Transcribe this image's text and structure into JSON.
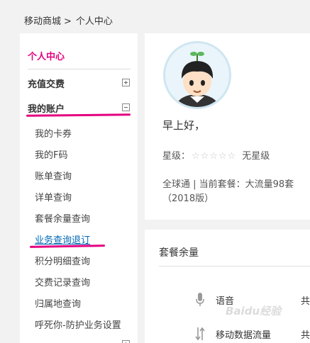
{
  "breadcrumb": {
    "home": "移动商城",
    "separator": ">",
    "current": "个人中心"
  },
  "sidebar": {
    "title": "个人中心",
    "sections": [
      {
        "label": "充值交费",
        "toggle": "plus"
      },
      {
        "label": "我的账户",
        "toggle": "minus"
      }
    ],
    "items": [
      {
        "label": "我的卡券"
      },
      {
        "label": "我的F码"
      },
      {
        "label": "账单查询"
      },
      {
        "label": "详单查询"
      },
      {
        "label": "套餐余量查询"
      },
      {
        "label": "业务查询退订"
      },
      {
        "label": "积分明细查询"
      },
      {
        "label": "交费记录查询"
      },
      {
        "label": "归属地查询"
      },
      {
        "label": "呼死你-防护业务设置"
      }
    ],
    "active_item": "业务查询退订",
    "highlight_color": "#e4007f"
  },
  "profile": {
    "greeting": "早上好，",
    "star_label": "星级：",
    "stars": "☆☆☆☆☆",
    "star_level": "无星级",
    "plan_line1": "全球通 | 当前套餐：大流量98套",
    "plan_line2": "（2018版）"
  },
  "package": {
    "title": "套餐余量",
    "rows": [
      {
        "label": "语音",
        "value": "共",
        "icon": "microphone-icon"
      },
      {
        "label": "移动数据流量",
        "value": "共",
        "icon": "data-transfer-icon"
      }
    ]
  },
  "watermark": "Baidu经验"
}
